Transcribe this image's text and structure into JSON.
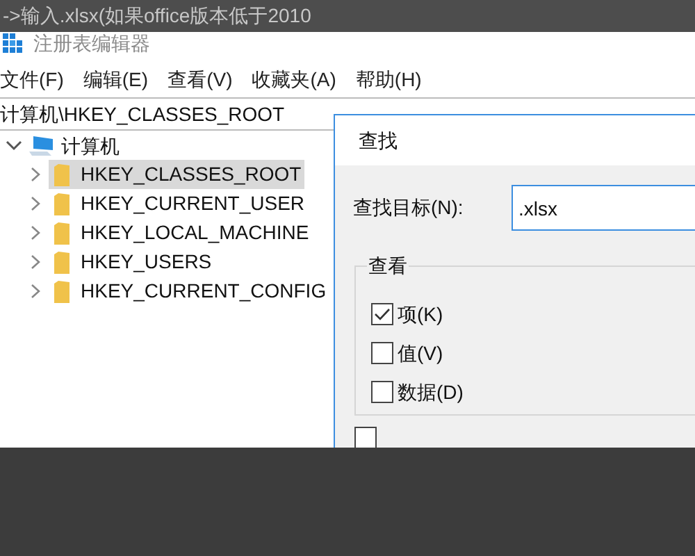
{
  "caption_overlay": {
    "text": "->输入.xlsx(如果office版本低于2010"
  },
  "window": {
    "title": "注册表编辑器"
  },
  "menu": [
    "文件(F)",
    "编辑(E)",
    "查看(V)",
    "收藏夹(A)",
    "帮助(H)"
  ],
  "address": "计算机\\HKEY_CLASSES_ROOT",
  "tree": {
    "label": "计算机",
    "expanded": true,
    "children": [
      {
        "label": "HKEY_CLASSES_ROOT",
        "selected": true
      },
      {
        "label": "HKEY_CURRENT_USER",
        "selected": false
      },
      {
        "label": "HKEY_LOCAL_MACHINE",
        "selected": false
      },
      {
        "label": "HKEY_USERS",
        "selected": false
      },
      {
        "label": "HKEY_CURRENT_CONFIG",
        "selected": false
      }
    ]
  },
  "find_dialog": {
    "title": "查找",
    "target_label": "查找目标(N):",
    "target_value": ".xlsx",
    "group_title": "查看",
    "options": [
      {
        "label": "项(K)",
        "checked": true
      },
      {
        "label": "值(V)",
        "checked": false
      },
      {
        "label": "数据(D)",
        "checked": false
      }
    ],
    "whole_match_checked": false
  }
}
